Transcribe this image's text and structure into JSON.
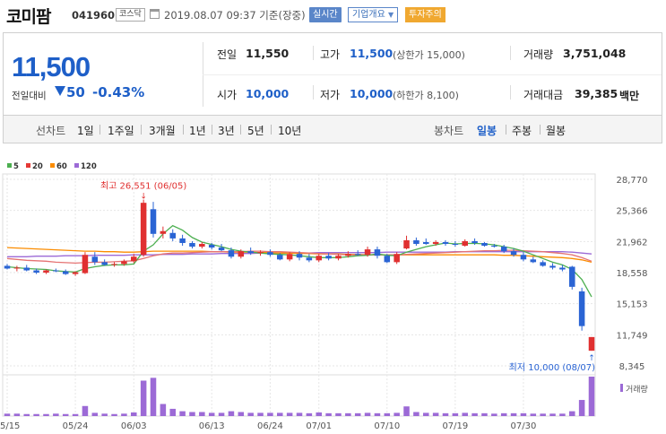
{
  "header": {
    "name": "코미팜",
    "code": "041960",
    "market": "코스닥",
    "datetime": "2019.08.07 09:37 기준(장중)",
    "realtime_label": "실시간",
    "company_label": "기업개요",
    "warning_label": "투자주의"
  },
  "summary": {
    "price": "11,500",
    "prev_diff_label": "전일대비",
    "change": "50",
    "change_pct": "-0.43%",
    "prev_close_label": "전일",
    "prev_close": "11,550",
    "open_label": "시가",
    "open": "10,000",
    "high_label": "고가",
    "high": "11,500",
    "upper_limit": "(상한가 15,000)",
    "low_label": "저가",
    "low": "10,000",
    "lower_limit": "(하한가 8,100)",
    "volume_label": "거래량",
    "volume": "3,751,048",
    "amount_label": "거래대금",
    "amount": "39,385",
    "amount_unit": "백만",
    "colors": {
      "down": "#1e5fc8",
      "up": "#e03030"
    }
  },
  "period_bar": {
    "line_label": "선차트",
    "line_periods": [
      "1일",
      "1주일",
      "3개월",
      "1년",
      "3년",
      "5년",
      "10년"
    ],
    "candle_label": "봉차트",
    "candle_periods": [
      "일봉",
      "주봉",
      "월봉"
    ],
    "active_candle": "일봉"
  },
  "chart_data": {
    "type": "candlestick",
    "legend": [
      {
        "label": "5",
        "color": "#4caf50"
      },
      {
        "label": "20",
        "color": "#e53935"
      },
      {
        "label": "60",
        "color": "#fb8c00"
      },
      {
        "label": "120",
        "color": "#9c6ad6"
      }
    ],
    "y_ticks": [
      "28,770",
      "25,366",
      "21,962",
      "18,558",
      "15,153",
      "11,749",
      "8,345"
    ],
    "ylim": [
      8345,
      28770
    ],
    "x_ticks": [
      "05/15",
      "05/24",
      "06/03",
      "06/13",
      "06/24",
      "07/01",
      "07/10",
      "07/19",
      "07/30"
    ],
    "x_tick_days": [
      0,
      7,
      13,
      21,
      27,
      32,
      39,
      46,
      53
    ],
    "high_annotation": "최고 26,551 (06/05)",
    "low_annotation": "최저 10,000 (08/07)",
    "volume_label": "거래량",
    "candles": [
      {
        "o": 19300,
        "h": 19500,
        "l": 18900,
        "c": 19000
      },
      {
        "o": 19000,
        "h": 19300,
        "l": 18700,
        "c": 19100
      },
      {
        "o": 19100,
        "h": 19400,
        "l": 18700,
        "c": 18800
      },
      {
        "o": 18800,
        "h": 19000,
        "l": 18400,
        "c": 18550
      },
      {
        "o": 18550,
        "h": 18900,
        "l": 18400,
        "c": 18800
      },
      {
        "o": 18800,
        "h": 19000,
        "l": 18600,
        "c": 18700
      },
      {
        "o": 18700,
        "h": 18900,
        "l": 18300,
        "c": 18400
      },
      {
        "o": 18400,
        "h": 18700,
        "l": 18200,
        "c": 18600
      },
      {
        "o": 18500,
        "h": 20800,
        "l": 18400,
        "c": 20500
      },
      {
        "o": 20300,
        "h": 20800,
        "l": 19400,
        "c": 19700
      },
      {
        "o": 19700,
        "h": 20000,
        "l": 19300,
        "c": 19400
      },
      {
        "o": 19400,
        "h": 19700,
        "l": 19200,
        "c": 19500
      },
      {
        "o": 19500,
        "h": 20000,
        "l": 19300,
        "c": 19800
      },
      {
        "o": 19800,
        "h": 20600,
        "l": 19600,
        "c": 20300
      },
      {
        "o": 20500,
        "h": 26551,
        "l": 20300,
        "c": 26200
      },
      {
        "o": 25500,
        "h": 26300,
        "l": 22400,
        "c": 22800
      },
      {
        "o": 22800,
        "h": 23600,
        "l": 22300,
        "c": 23100
      },
      {
        "o": 22900,
        "h": 23300,
        "l": 22000,
        "c": 22300
      },
      {
        "o": 22300,
        "h": 22700,
        "l": 21500,
        "c": 21800
      },
      {
        "o": 21800,
        "h": 22000,
        "l": 21200,
        "c": 21400
      },
      {
        "o": 21400,
        "h": 21900,
        "l": 21200,
        "c": 21700
      },
      {
        "o": 21600,
        "h": 21800,
        "l": 21100,
        "c": 21300
      },
      {
        "o": 21300,
        "h": 21700,
        "l": 20900,
        "c": 21000
      },
      {
        "o": 21000,
        "h": 21300,
        "l": 20100,
        "c": 20300
      },
      {
        "o": 20300,
        "h": 21100,
        "l": 20100,
        "c": 20900
      },
      {
        "o": 20900,
        "h": 21300,
        "l": 20500,
        "c": 20700
      },
      {
        "o": 20700,
        "h": 21000,
        "l": 20400,
        "c": 20800
      },
      {
        "o": 20800,
        "h": 21100,
        "l": 20300,
        "c": 20500
      },
      {
        "o": 20500,
        "h": 20700,
        "l": 19900,
        "c": 20000
      },
      {
        "o": 20000,
        "h": 20800,
        "l": 19800,
        "c": 20600
      },
      {
        "o": 20600,
        "h": 20900,
        "l": 19900,
        "c": 20200
      },
      {
        "o": 20200,
        "h": 20600,
        "l": 19700,
        "c": 19900
      },
      {
        "o": 19900,
        "h": 20600,
        "l": 19700,
        "c": 20400
      },
      {
        "o": 20400,
        "h": 20700,
        "l": 19900,
        "c": 20100
      },
      {
        "o": 20100,
        "h": 20600,
        "l": 19900,
        "c": 20400
      },
      {
        "o": 20400,
        "h": 20900,
        "l": 20200,
        "c": 20600
      },
      {
        "o": 20600,
        "h": 21000,
        "l": 20400,
        "c": 20500
      },
      {
        "o": 20500,
        "h": 21400,
        "l": 20300,
        "c": 21100
      },
      {
        "o": 21100,
        "h": 21400,
        "l": 20100,
        "c": 20400
      },
      {
        "o": 20400,
        "h": 20600,
        "l": 19600,
        "c": 19700
      },
      {
        "o": 19700,
        "h": 20800,
        "l": 19500,
        "c": 20600
      },
      {
        "o": 21200,
        "h": 22600,
        "l": 21100,
        "c": 22100
      },
      {
        "o": 22100,
        "h": 22400,
        "l": 21500,
        "c": 21700
      },
      {
        "o": 21900,
        "h": 22300,
        "l": 21600,
        "c": 21700
      },
      {
        "o": 21700,
        "h": 22100,
        "l": 21500,
        "c": 21900
      },
      {
        "o": 21900,
        "h": 22100,
        "l": 21500,
        "c": 21700
      },
      {
        "o": 21700,
        "h": 22000,
        "l": 21400,
        "c": 21600
      },
      {
        "o": 21500,
        "h": 22200,
        "l": 21400,
        "c": 22000
      },
      {
        "o": 22000,
        "h": 22300,
        "l": 21600,
        "c": 21800
      },
      {
        "o": 21800,
        "h": 21900,
        "l": 21400,
        "c": 21500
      },
      {
        "o": 21500,
        "h": 21700,
        "l": 21300,
        "c": 21400
      },
      {
        "o": 21400,
        "h": 21600,
        "l": 20700,
        "c": 20900
      },
      {
        "o": 20900,
        "h": 21200,
        "l": 20300,
        "c": 20500
      },
      {
        "o": 20500,
        "h": 20800,
        "l": 19800,
        "c": 20000
      },
      {
        "o": 20000,
        "h": 20300,
        "l": 19600,
        "c": 19700
      },
      {
        "o": 19700,
        "h": 19900,
        "l": 19200,
        "c": 19300
      },
      {
        "o": 19300,
        "h": 19600,
        "l": 18900,
        "c": 19100
      },
      {
        "o": 19100,
        "h": 19400,
        "l": 18700,
        "c": 18900
      },
      {
        "o": 19200,
        "h": 19300,
        "l": 16700,
        "c": 17000
      },
      {
        "o": 16500,
        "h": 16900,
        "l": 12200,
        "c": 12700
      },
      {
        "o": 10000,
        "h": 11500,
        "l": 10000,
        "c": 11500
      }
    ],
    "volumes": [
      6,
      6,
      5,
      5,
      5,
      6,
      5,
      5,
      25,
      8,
      6,
      5,
      6,
      9,
      88,
      95,
      30,
      18,
      12,
      10,
      10,
      8,
      8,
      12,
      10,
      8,
      8,
      8,
      8,
      8,
      8,
      7,
      9,
      7,
      7,
      7,
      7,
      8,
      7,
      7,
      8,
      24,
      10,
      8,
      8,
      7,
      7,
      8,
      7,
      7,
      6,
      7,
      7,
      7,
      6,
      6,
      6,
      6,
      12,
      40,
      98
    ],
    "ma5": [
      19200,
      19100,
      19000,
      18950,
      18900,
      18750,
      18680,
      18620,
      19000,
      19200,
      19340,
      19400,
      19400,
      19500,
      20900,
      21600,
      22800,
      23700,
      23200,
      22400,
      21900,
      21640,
      21400,
      21100,
      20900,
      20800,
      20700,
      20600,
      20550,
      20500,
      20400,
      20300,
      20200,
      20200,
      20200,
      20300,
      20400,
      20450,
      20600,
      20450,
      20400,
      20800,
      21100,
      21400,
      21600,
      21800,
      21700,
      21750,
      21760,
      21700,
      21600,
      21400,
      21200,
      20900,
      20500,
      20100,
      19700,
      19400,
      18900,
      17800,
      15900
    ],
    "ma20": [
      20100,
      20000,
      19900,
      19850,
      19800,
      19700,
      19650,
      19600,
      19650,
      19700,
      19700,
      19750,
      19800,
      19850,
      20100,
      20400,
      20600,
      20700,
      20700,
      20750,
      20800,
      20850,
      20850,
      20850,
      20850,
      20900,
      20900,
      20850,
      20850,
      20800,
      20750,
      20700,
      20650,
      20600,
      20550,
      20500,
      20500,
      20500,
      20500,
      20500,
      20500,
      20550,
      20600,
      20650,
      20700,
      20750,
      20800,
      20850,
      20900,
      20950,
      20950,
      21000,
      21000,
      20950,
      20900,
      20850,
      20750,
      20650,
      20500,
      20200,
      19800
    ],
    "ma60": [
      21300,
      21250,
      21200,
      21150,
      21100,
      21050,
      21000,
      20950,
      20900,
      20900,
      20850,
      20850,
      20800,
      20800,
      20850,
      20900,
      20900,
      20900,
      20900,
      20900,
      20900,
      20850,
      20850,
      20800,
      20800,
      20800,
      20750,
      20750,
      20700,
      20700,
      20650,
      20650,
      20600,
      20600,
      20600,
      20550,
      20550,
      20500,
      20500,
      20500,
      20500,
      20500,
      20500,
      20500,
      20500,
      20500,
      20500,
      20500,
      20500,
      20500,
      20500,
      20450,
      20450,
      20400,
      20350,
      20300,
      20250,
      20200,
      20100,
      19950,
      19700
    ],
    "ma120": [
      20300,
      20300,
      20300,
      20350,
      20350,
      20350,
      20400,
      20400,
      20400,
      20450,
      20450,
      20450,
      20450,
      20500,
      20500,
      20500,
      20550,
      20550,
      20550,
      20600,
      20600,
      20600,
      20650,
      20650,
      20650,
      20650,
      20700,
      20700,
      20700,
      20700,
      20700,
      20700,
      20750,
      20750,
      20750,
      20750,
      20750,
      20750,
      20750,
      20800,
      20800,
      20800,
      20800,
      20800,
      20800,
      20800,
      20850,
      20850,
      20850,
      20850,
      20850,
      20850,
      20850,
      20850,
      20850,
      20850,
      20850,
      20850,
      20800,
      20700,
      20600
    ]
  }
}
